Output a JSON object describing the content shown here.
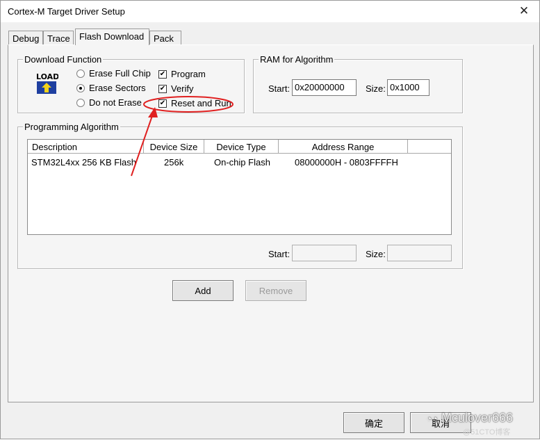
{
  "window": {
    "title": "Cortex-M Target Driver Setup"
  },
  "tabs": [
    {
      "label": "Debug"
    },
    {
      "label": "Trace"
    },
    {
      "label": "Flash Download"
    },
    {
      "label": "Pack"
    }
  ],
  "download_function": {
    "title": "Download Function",
    "load_icon_text": "LOAD",
    "options": [
      {
        "label": "Erase Full Chip",
        "selected": false
      },
      {
        "label": "Erase Sectors",
        "selected": true
      },
      {
        "label": "Do not Erase",
        "selected": false
      }
    ],
    "checks": [
      {
        "label": "Program",
        "checked": true
      },
      {
        "label": "Verify",
        "checked": true
      },
      {
        "label": "Reset and Run",
        "checked": true
      }
    ]
  },
  "ram_for_algorithm": {
    "title": "RAM for Algorithm",
    "start_label": "Start:",
    "start_value": "0x20000000",
    "size_label": "Size:",
    "size_value": "0x1000"
  },
  "programming_algorithm": {
    "title": "Programming Algorithm",
    "columns": [
      "Description",
      "Device Size",
      "Device Type",
      "Address Range"
    ],
    "rows": [
      {
        "description": "STM32L4xx 256 KB Flash",
        "size": "256k",
        "type": "On-chip Flash",
        "range": "08000000H - 0803FFFFH"
      }
    ],
    "start_label": "Start:",
    "size_label": "Size:"
  },
  "buttons": {
    "add": "Add",
    "remove": "Remove",
    "ok": "确定",
    "cancel": "取消"
  },
  "watermark": {
    "text": "Mculover666",
    "sub": "@51CTO博客"
  },
  "colors": {
    "annotation": "#e02020"
  }
}
